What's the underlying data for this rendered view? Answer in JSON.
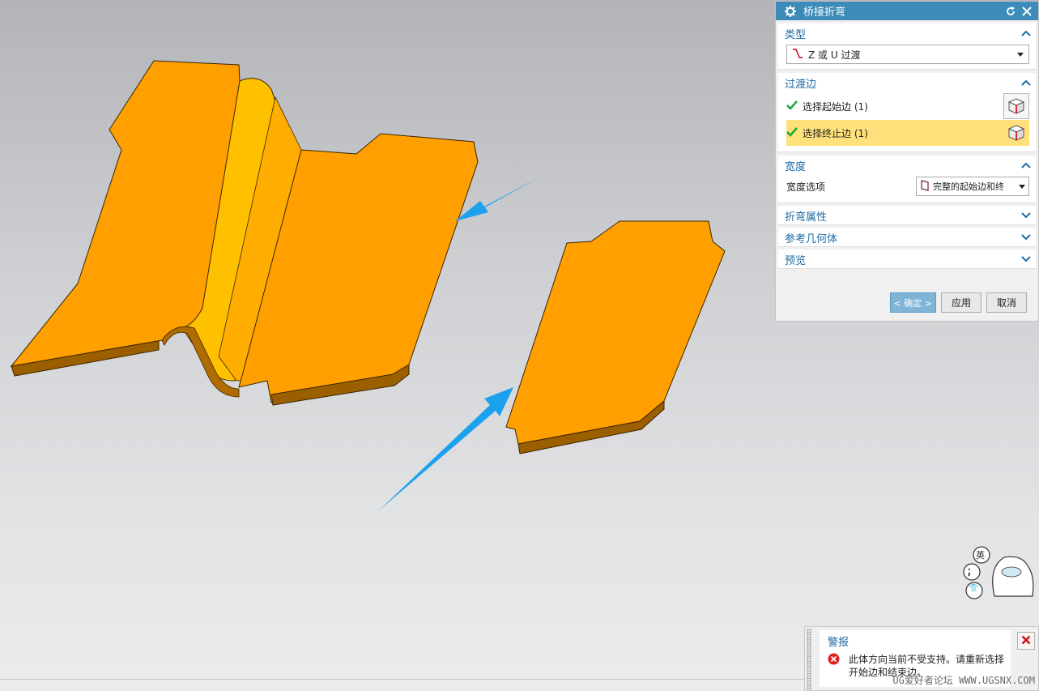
{
  "colors": {
    "dialog_header": "#3d8bb8",
    "section_label": "#1e6ba3",
    "active_row": "#ffe07a",
    "part_orange": "#ff9f00",
    "arrow_blue": "#1ba1ee"
  },
  "dialog": {
    "title": "桥接折弯",
    "icons": [
      "gear-icon",
      "reset-icon",
      "close-icon"
    ],
    "type_section": {
      "label": "类型",
      "selected": "Z 或 U 过渡"
    },
    "edges_section": {
      "label": "过渡边",
      "start_edge": "选择起始边 (1)",
      "end_edge": "选择终止边 (1)"
    },
    "width_section": {
      "label": "宽度",
      "option_label": "宽度选项",
      "option_value": "完整的起始边和终"
    },
    "bend_props": {
      "label": "折弯属性"
    },
    "ref_geometry": {
      "label": "参考几何体"
    },
    "preview": {
      "label": "预览"
    },
    "buttons": {
      "ok": "< 确定 >",
      "apply": "应用",
      "cancel": "取消"
    }
  },
  "alert": {
    "title": "警报",
    "message": "此体方向当前不受支持。请重新选择开始边和结束边。"
  },
  "mascot": {
    "bubbles": [
      "英",
      "；",
      "👕"
    ]
  },
  "watermark": "UG爱好者论坛 WWW.UGSNX.COM"
}
